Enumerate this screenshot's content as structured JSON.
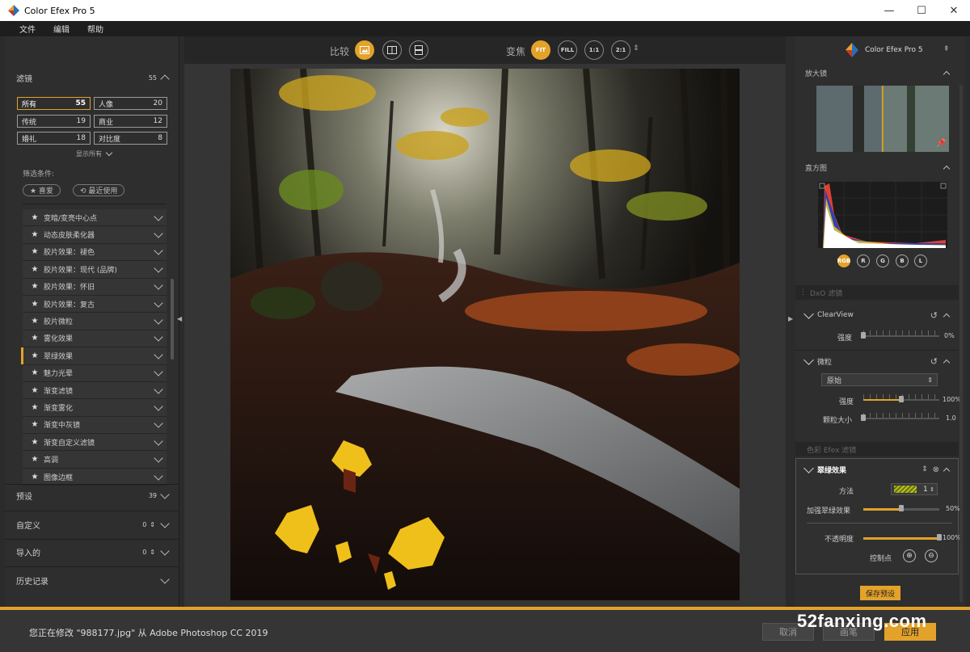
{
  "window": {
    "title": "Color Efex Pro 5",
    "minimize": "—",
    "maximize": "☐",
    "close": "✕"
  },
  "menu": [
    "文件",
    "编辑",
    "帮助"
  ],
  "left": {
    "filters_title": "滤镜",
    "filters_count": "55",
    "categories": [
      {
        "label": "所有",
        "count": "55",
        "selected": true
      },
      {
        "label": "人像",
        "count": "20"
      },
      {
        "label": "传统",
        "count": "19"
      },
      {
        "label": "商业",
        "count": "12"
      },
      {
        "label": "婚礼",
        "count": "18"
      },
      {
        "label": "对比度",
        "count": "8"
      }
    ],
    "show_all": "显示所有",
    "filter_criteria": "筛选条件:",
    "favorite": "★ 喜爱",
    "recent": "⟲ 最近使用",
    "filter_items": [
      "变暗/变亮中心点",
      "动态皮肤柔化器",
      "胶片效果：褪色",
      "胶片效果：现代 (品牌)",
      "胶片效果：怀旧",
      "胶片效果：复古",
      "胶片微粒",
      "雾化效果",
      "翠绿效果",
      "魅力光晕",
      "渐变滤镜",
      "渐变雾化",
      "渐变中灰镜",
      "渐变自定义滤镜",
      "高调",
      "图像边框"
    ],
    "active_filter_index": 8,
    "presets": {
      "label": "预设",
      "count": "39"
    },
    "custom": {
      "label": "自定义",
      "count": "0"
    },
    "imported": {
      "label": "导入的",
      "count": "0"
    },
    "history": {
      "label": "历史记录"
    }
  },
  "toolbar": {
    "compare_label": "比较",
    "zoom_label": "变焦",
    "fit": "FIT",
    "fill": "FILL",
    "one": "1:1",
    "two": "2:1"
  },
  "right": {
    "brand": "Color Efex Pro 5",
    "loupe_title": "放大镜",
    "histogram_title": "直方图",
    "channels": [
      "RGB",
      "R",
      "G",
      "B",
      "L"
    ],
    "dxo_section": "DxO 滤镜",
    "clearview": {
      "label": "ClearView",
      "strength_label": "强度",
      "strength_value": "0%",
      "strength": 0.0
    },
    "grain": {
      "label": "微粒",
      "mode": "原始",
      "strength_label": "强度",
      "strength_value": "100%",
      "strength": 0.5,
      "size_label": "颗粒大小",
      "size_value": "1.0",
      "size": 0.0
    },
    "color_section": "色彩 Efex 滤镜",
    "green": {
      "label": "翠绿效果",
      "method_label": "方法",
      "method_value": "1",
      "enhance_label": "加强翠绿效果",
      "enhance_value": "50%",
      "enhance": 0.5,
      "opacity_label": "不透明度",
      "opacity_value": "100%",
      "opacity": 1.0,
      "control_points_label": "控制点"
    },
    "save_preset": "保存预设"
  },
  "status": {
    "text": "您正在修改 \"988177.jpg\" 从 Adobe Photoshop CC 2019",
    "cancel": "取消",
    "brush": "画笔",
    "apply": "应用"
  },
  "watermark": "52fanxing.com",
  "colors": {
    "accent": "#e3a22a",
    "panel": "#2e2e2e",
    "canvas": "#353535"
  }
}
